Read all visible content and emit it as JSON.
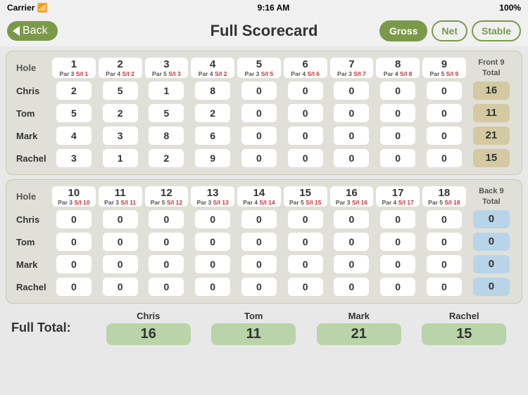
{
  "status": {
    "carrier": "Carrier",
    "wifi": "wifi",
    "time": "9:16 AM",
    "battery": "100%"
  },
  "nav": {
    "back_label": "Back",
    "title": "Full Scorecard",
    "gross_label": "Gross",
    "net_label": "Net",
    "stable_label": "Stable",
    "active_tab": "Gross"
  },
  "front9": {
    "section_label": "Front 9",
    "total_label": "Front 9\nTotal",
    "holes": [
      {
        "num": "1",
        "par": "Par",
        "par_val": "3",
        "si": "S/I",
        "si_val": "1"
      },
      {
        "num": "2",
        "par": "Par",
        "par_val": "4",
        "si": "S/I",
        "si_val": "2"
      },
      {
        "num": "3",
        "par": "Par",
        "par_val": "5",
        "si": "S/I",
        "si_val": "3"
      },
      {
        "num": "4",
        "par": "Par",
        "par_val": "4",
        "si": "S/I",
        "si_val": "2"
      },
      {
        "num": "5",
        "par": "Par",
        "par_val": "3",
        "si": "S/I",
        "si_val": "5"
      },
      {
        "num": "6",
        "par": "Par",
        "par_val": "4",
        "si": "S/I",
        "si_val": "6"
      },
      {
        "num": "7",
        "par": "Par",
        "par_val": "3",
        "si": "S/I",
        "si_val": "7"
      },
      {
        "num": "8",
        "par": "Par",
        "par_val": "4",
        "si": "S/I",
        "si_val": "8"
      },
      {
        "num": "9",
        "par": "Par",
        "par_val": "5",
        "si": "S/I",
        "si_val": "9"
      }
    ],
    "players": [
      {
        "name": "Chris",
        "scores": [
          2,
          5,
          1,
          8,
          0,
          0,
          0,
          0,
          0
        ],
        "total": 16
      },
      {
        "name": "Tom",
        "scores": [
          5,
          2,
          5,
          2,
          0,
          0,
          0,
          0,
          0
        ],
        "total": 11
      },
      {
        "name": "Mark",
        "scores": [
          4,
          3,
          8,
          6,
          0,
          0,
          0,
          0,
          0
        ],
        "total": 21
      },
      {
        "name": "Rachel",
        "scores": [
          3,
          1,
          2,
          9,
          0,
          0,
          0,
          0,
          0
        ],
        "total": 15
      }
    ]
  },
  "back9": {
    "section_label": "Back 9",
    "total_label": "Back 9\nTotal",
    "holes": [
      {
        "num": "10",
        "par": "Par",
        "par_val": "3",
        "si": "S/I",
        "si_val": "10"
      },
      {
        "num": "11",
        "par": "Par",
        "par_val": "3",
        "si": "S/I",
        "si_val": "11"
      },
      {
        "num": "12",
        "par": "Par",
        "par_val": "5",
        "si": "S/I",
        "si_val": "12"
      },
      {
        "num": "13",
        "par": "Par",
        "par_val": "3",
        "si": "S/I",
        "si_val": "13"
      },
      {
        "num": "14",
        "par": "Par",
        "par_val": "4",
        "si": "S/I",
        "si_val": "14"
      },
      {
        "num": "15",
        "par": "Par",
        "par_val": "5",
        "si": "S/I",
        "si_val": "15"
      },
      {
        "num": "16",
        "par": "Par",
        "par_val": "3",
        "si": "S/I",
        "si_val": "16"
      },
      {
        "num": "17",
        "par": "Par",
        "par_val": "4",
        "si": "S/I",
        "si_val": "17"
      },
      {
        "num": "18",
        "par": "Par",
        "par_val": "5",
        "si": "S/I",
        "si_val": "18"
      }
    ],
    "players": [
      {
        "name": "Chris",
        "scores": [
          0,
          0,
          0,
          0,
          0,
          0,
          0,
          0,
          0
        ],
        "total": 0
      },
      {
        "name": "Tom",
        "scores": [
          0,
          0,
          0,
          0,
          0,
          0,
          0,
          0,
          0
        ],
        "total": 0
      },
      {
        "name": "Mark",
        "scores": [
          0,
          0,
          0,
          0,
          0,
          0,
          0,
          0,
          0
        ],
        "total": 0
      },
      {
        "name": "Rachel",
        "scores": [
          0,
          0,
          0,
          0,
          0,
          0,
          0,
          0,
          0
        ],
        "total": 0
      }
    ]
  },
  "full_totals": {
    "label": "Full Total:",
    "players": [
      {
        "name": "Chris",
        "total": 16
      },
      {
        "name": "Tom",
        "total": 11
      },
      {
        "name": "Mark",
        "total": 21
      },
      {
        "name": "Rachel",
        "total": 15
      }
    ]
  }
}
